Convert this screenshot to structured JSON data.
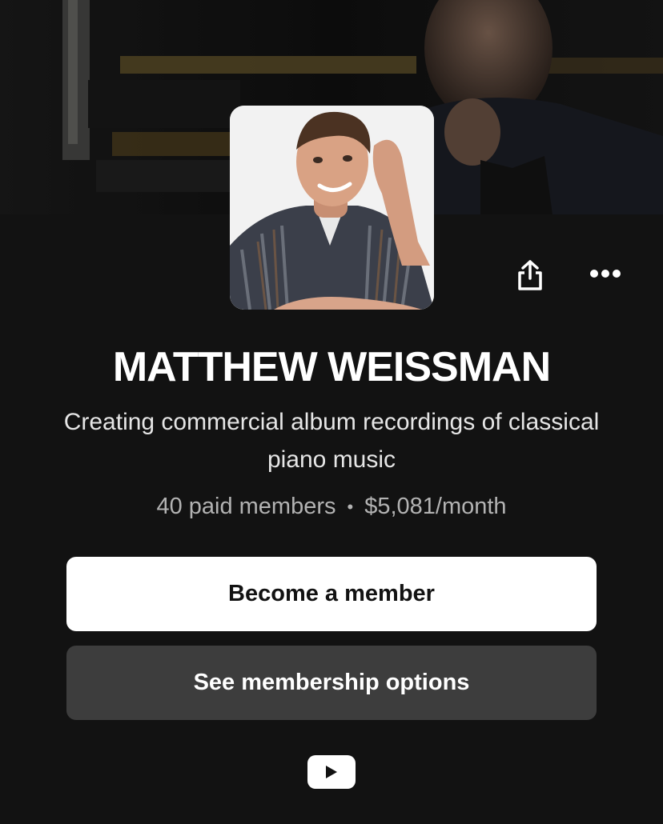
{
  "profile": {
    "name": "MATTHEW WEISSMAN",
    "tagline": "Creating commercial album recordings of classical piano music",
    "paid_members": "40 paid members",
    "separator": "•",
    "earnings": "$5,081/month"
  },
  "actions": {
    "primary_label": "Become a member",
    "secondary_label": "See membership options"
  },
  "icons": {
    "share": "share-icon",
    "more": "more-icon",
    "social": "youtube-icon"
  },
  "colors": {
    "background": "#121212",
    "primary_button": "#ffffff",
    "secondary_button": "#3d3d3d",
    "muted_text": "#b3b3b3"
  }
}
